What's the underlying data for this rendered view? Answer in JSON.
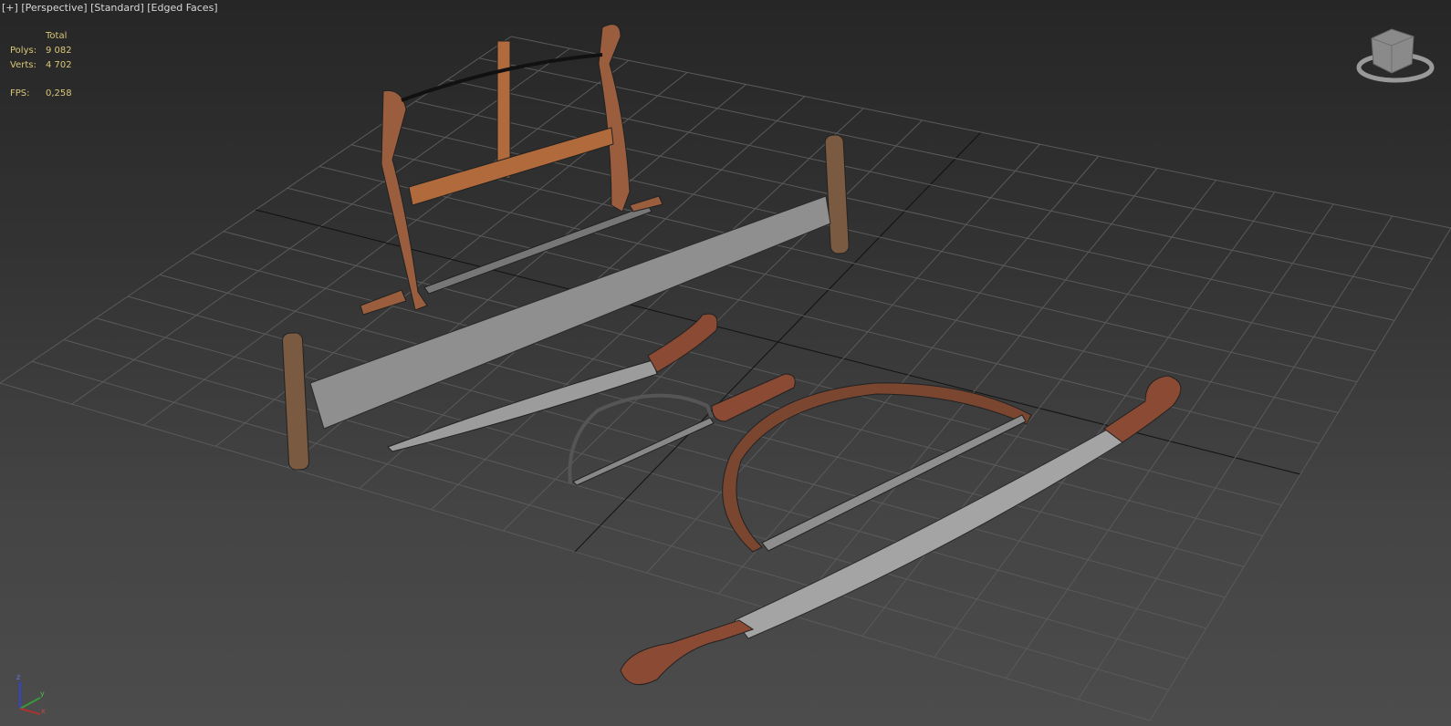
{
  "viewport": {
    "menu_plus": "[+]",
    "view": "[Perspective]",
    "shading": "[Standard]",
    "edged": "[Edged Faces]"
  },
  "stats": {
    "header": "Total",
    "polys_label": "Polys:",
    "polys_value": "9 082",
    "verts_label": "Verts:",
    "verts_value": "4 702",
    "fps_label": "FPS:",
    "fps_value": "0,258"
  },
  "gizmo": {
    "x": "x",
    "y": "y",
    "z": "z"
  },
  "colors": {
    "wood": "#8a5238",
    "blade": "#9a9a9a",
    "stats": "#d9c777"
  }
}
